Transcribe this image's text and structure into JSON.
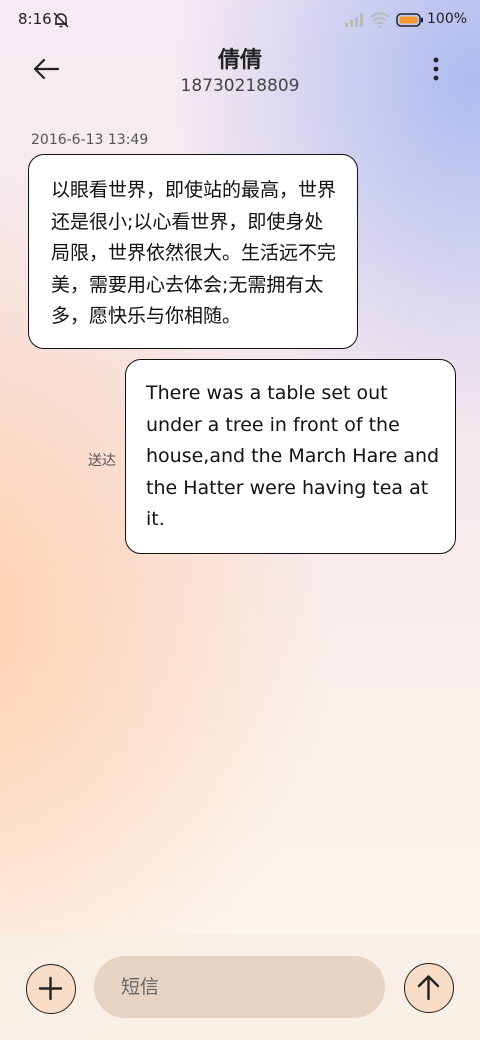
{
  "status_bar": {
    "time": "8:16",
    "battery": "100%",
    "icons": [
      "bell-muted-icon",
      "signal-icon",
      "wifi-icon",
      "battery-icon"
    ]
  },
  "header": {
    "contact_name": "倩倩",
    "contact_number": "18730218809",
    "icons": [
      "back-arrow-icon",
      "more-vertical-icon"
    ]
  },
  "conversation": {
    "timestamp": "2016-6-13 13:49",
    "messages": [
      {
        "direction": "incoming",
        "lines": [
          "以眼看世界，即使站的最高，世界",
          "还是很小;以心看世界，即使身处",
          "局限，世界依然很大。生活远不完",
          "美，需要用心去体会;无需拥有太",
          "多，愿快乐与你相随。"
        ]
      },
      {
        "direction": "outgoing",
        "lines": [
          "There was a table set out",
          "under a tree in front of the",
          "house,and the March Hare and",
          "the Hatter were having tea at",
          "it."
        ],
        "status": "送达"
      }
    ]
  },
  "input_bar": {
    "placeholder": "短信",
    "icons": [
      "plus-icon",
      "send-arrow-up-icon"
    ]
  },
  "colors": {
    "bubble_background": "#ffffff",
    "bubble_border": "#111111",
    "input_background": "#e7d4c4",
    "round_button_background": "#f7dcc8"
  }
}
